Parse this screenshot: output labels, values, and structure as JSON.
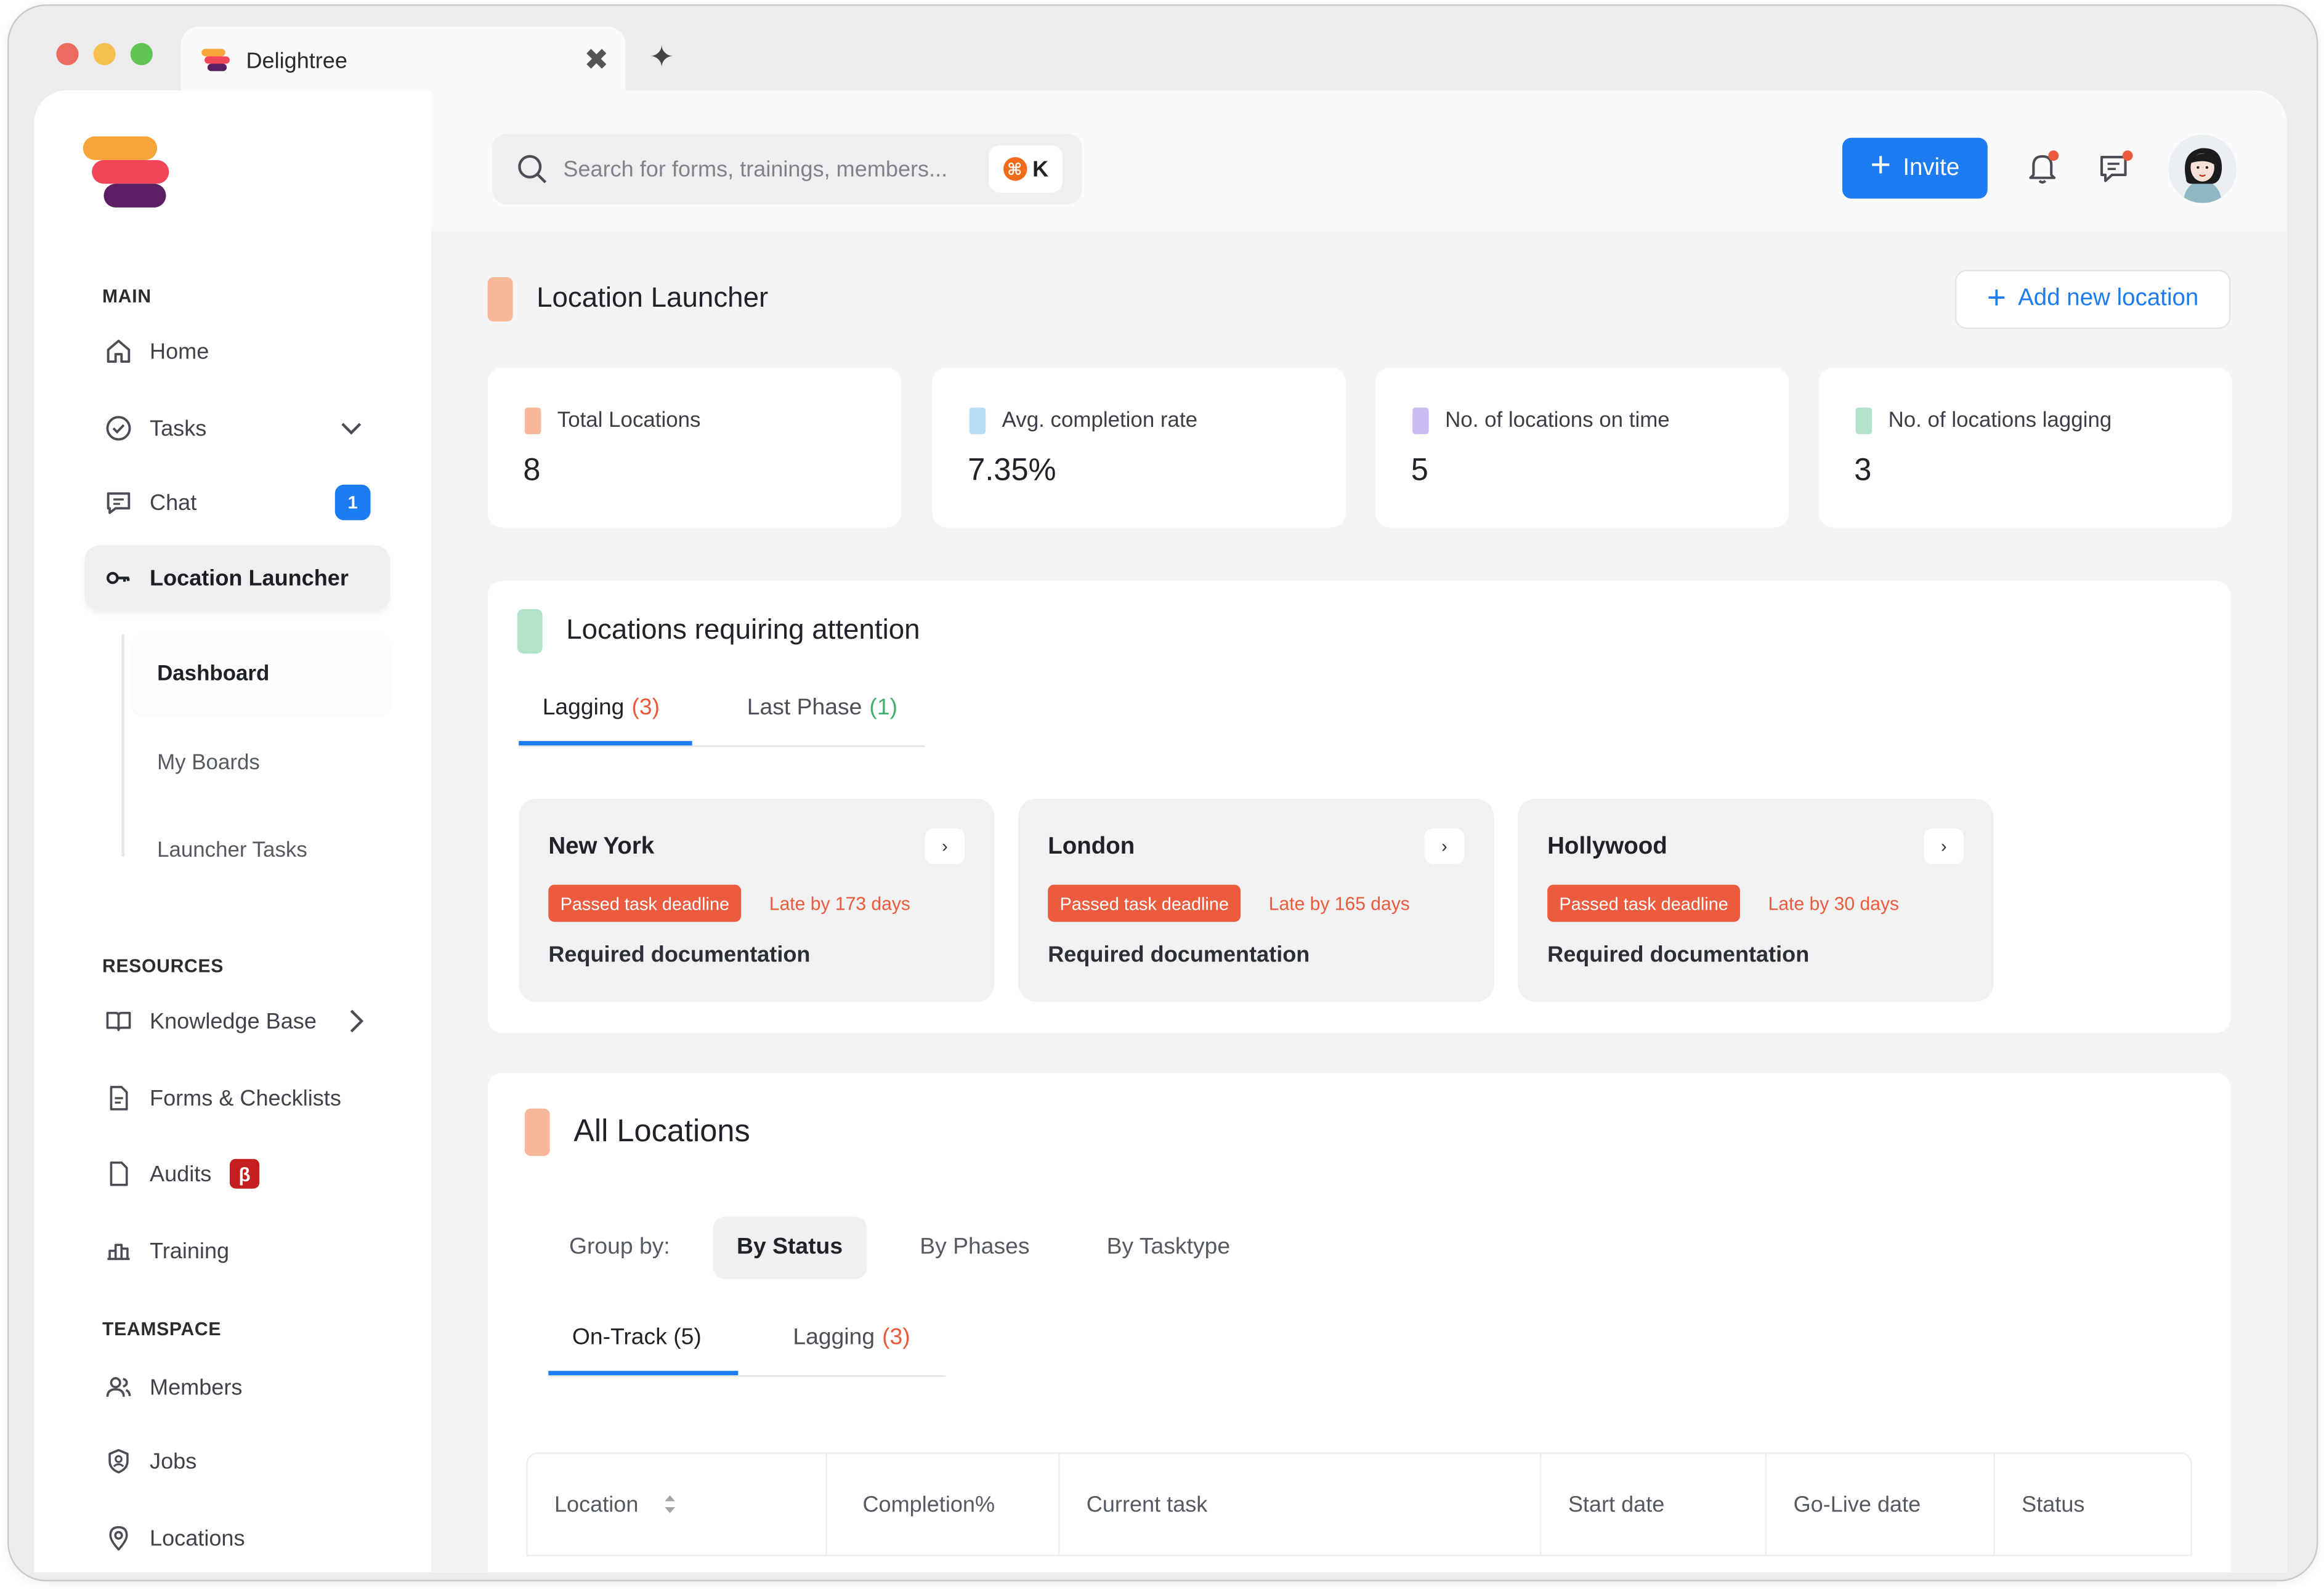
{
  "browser": {
    "tab_title": "Delightree",
    "lights": [
      "#ed6a5e",
      "#f5bf4f",
      "#61c554"
    ]
  },
  "colors": {
    "accent_blue": "#1d7cf2",
    "danger": "#ec5b3e",
    "peach": "#f8b99a",
    "light_blue": "#b8def6",
    "lavender": "#cbbef4",
    "mint": "#b3e3cb"
  },
  "sidebar": {
    "main_label": "MAIN",
    "home": "Home",
    "tasks": "Tasks",
    "chat": "Chat",
    "chat_badge": "1",
    "location_launcher": "Location Launcher",
    "sub_items": [
      "Dashboard",
      "My Boards",
      "Launcher Tasks"
    ],
    "resources_label": "RESOURCES",
    "knowledge_base": "Knowledge Base",
    "forms": "Forms & Checklists",
    "audits": "Audits",
    "audits_badge": "β",
    "training": "Training",
    "teamspace_label": "TEAMSPACE",
    "members": "Members",
    "jobs": "Jobs",
    "locations": "Locations"
  },
  "header": {
    "search_placeholder": "Search for forms, trainings, members...",
    "search_shortcut": "K",
    "invite_label": "Invite"
  },
  "page": {
    "title": "Location Launcher",
    "add_location": "Add new location"
  },
  "stats": [
    {
      "label": "Total Locations",
      "value": "8",
      "color": "#f8b99a"
    },
    {
      "label": "Avg. completion rate",
      "value": "7.35%",
      "color": "#b8def6"
    },
    {
      "label": "No. of locations on time",
      "value": "5",
      "color": "#cbbef4"
    },
    {
      "label": "No. of locations lagging",
      "value": "3",
      "color": "#b3e3cb"
    }
  ],
  "attention": {
    "title": "Locations requiring attention",
    "tab_lagging": "Lagging",
    "tab_lagging_count": "(3)",
    "tab_last_phase": "Last Phase",
    "tab_last_phase_count": "(1)",
    "cards": [
      {
        "city": "New York",
        "pill": "Passed task deadline",
        "late": "Late by 173 days",
        "req": "Required documentation"
      },
      {
        "city": "London",
        "pill": "Passed task deadline",
        "late": "Late by 165 days",
        "req": "Required documentation"
      },
      {
        "city": "Hollywood",
        "pill": "Passed task deadline",
        "late": "Late by 30 days",
        "req": "Required documentation"
      }
    ]
  },
  "all_locations": {
    "title": "All Locations",
    "group_by_label": "Group by:",
    "group_options": [
      "By Status",
      "By Phases",
      "By Tasktype"
    ],
    "tab_on_track": "On-Track (5)",
    "tab_lagging": "Lagging",
    "tab_lagging_count": "(3)",
    "columns": [
      "Location",
      "Completion%",
      "Current task",
      "Start date",
      "Go-Live date",
      "Status"
    ]
  }
}
